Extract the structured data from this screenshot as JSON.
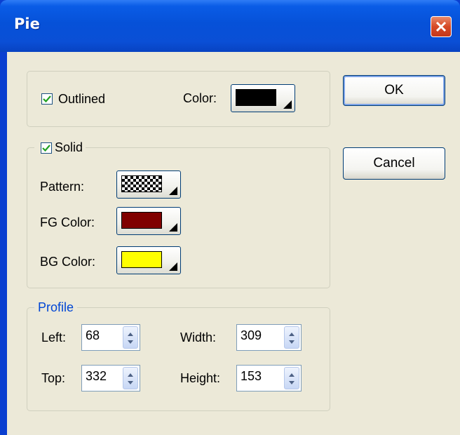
{
  "window": {
    "title": "Pie"
  },
  "outline": {
    "label": "Outlined",
    "checked": true,
    "color_label": "Color:",
    "color": "#000000"
  },
  "solid": {
    "label": "Solid",
    "checked": true,
    "pattern_label": "Pattern:",
    "pattern": "checkerboard",
    "fg_label": "FG Color:",
    "fg_color": "#800000",
    "bg_label": "BG Color:",
    "bg_color": "#ffff00"
  },
  "profile": {
    "title": "Profile",
    "left_label": "Left:",
    "left": "68",
    "top_label": "Top:",
    "top": "332",
    "width_label": "Width:",
    "width": "309",
    "height_label": "Height:",
    "height": "153"
  },
  "buttons": {
    "ok": "OK",
    "cancel": "Cancel"
  },
  "icons": {
    "close": "close-x-icon",
    "dropdown": "dropdown-arrow-icon",
    "spin": "spin-up-down-icon",
    "check": "checkmark-icon"
  },
  "colors": {
    "title_bar": "#0a55e0",
    "dialog_bg": "#ece9d8",
    "profile_title": "#0046d5",
    "close_button": "#d64a26"
  }
}
